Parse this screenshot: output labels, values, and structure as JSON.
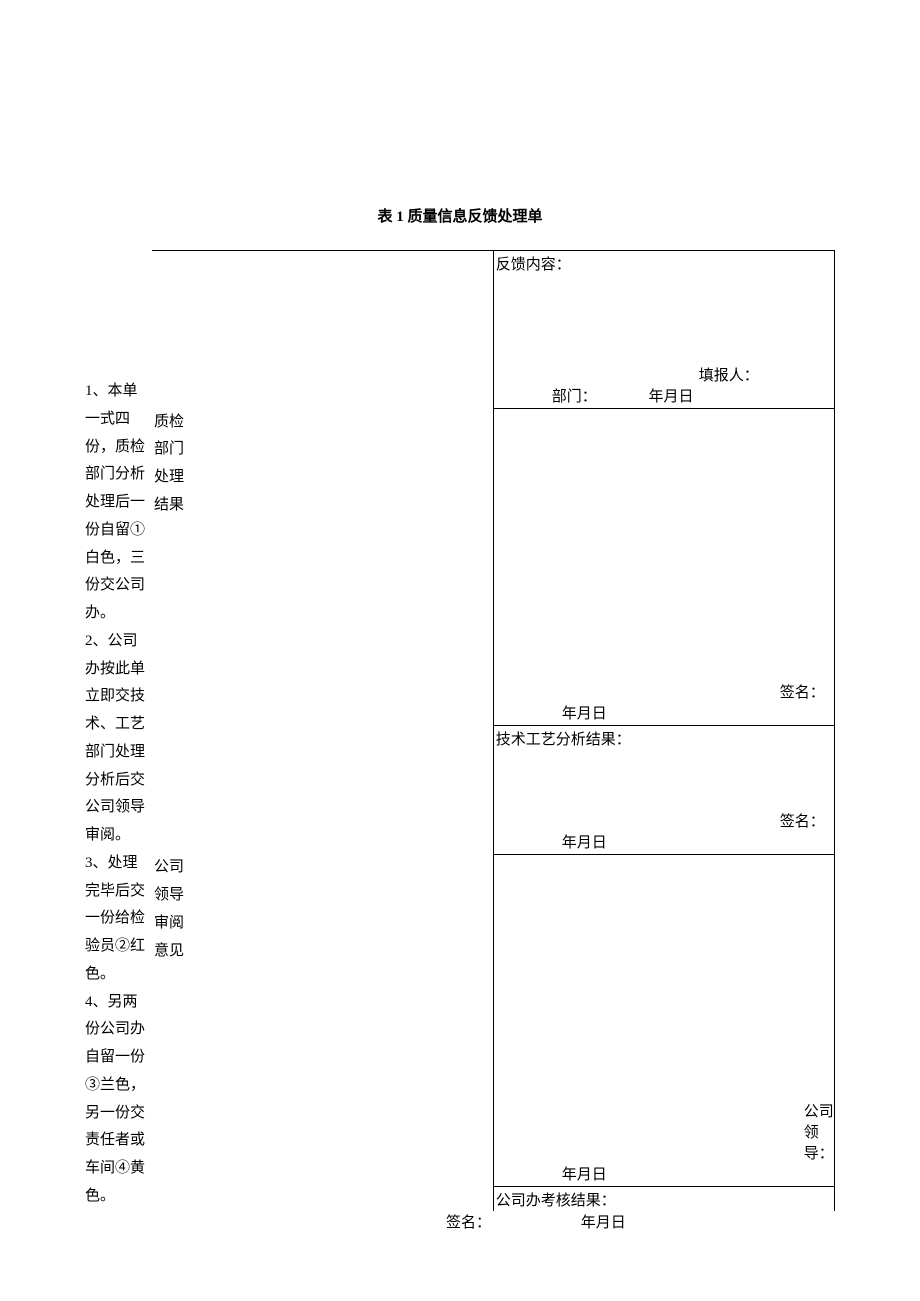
{
  "title": "表 1 质量信息反馈处理单",
  "left_notes": "1、本单一式四份，质检部门分析处理后一份自留①白色，三份交公司办。\n2、公司办按此单立即交技术、工艺部门处理分析后交公司领导审阅。\n3、处理完毕后交一份给检验员②红色。\n4、另两份公司办自留一份③兰色，另一份交责任者或车间④黄色。",
  "rows": {
    "r1": {
      "label": "",
      "top_label": "反馈内容：",
      "filler": "填报人：",
      "dept": "部门：",
      "date": "年月日"
    },
    "r2": {
      "label": "质检部门处理结果",
      "sign": "签名：",
      "date": "年月日"
    },
    "r3": {
      "top_label": "技术工艺分析结果：",
      "sign": "签名：",
      "date": "年月日"
    },
    "r4": {
      "label": "公司领导审阅意见",
      "leader": "公司领导：",
      "date": "年月日"
    },
    "r5": {
      "top_label": "公司办考核结果："
    }
  },
  "footer": {
    "sign": "签名：",
    "date": "年月日"
  }
}
